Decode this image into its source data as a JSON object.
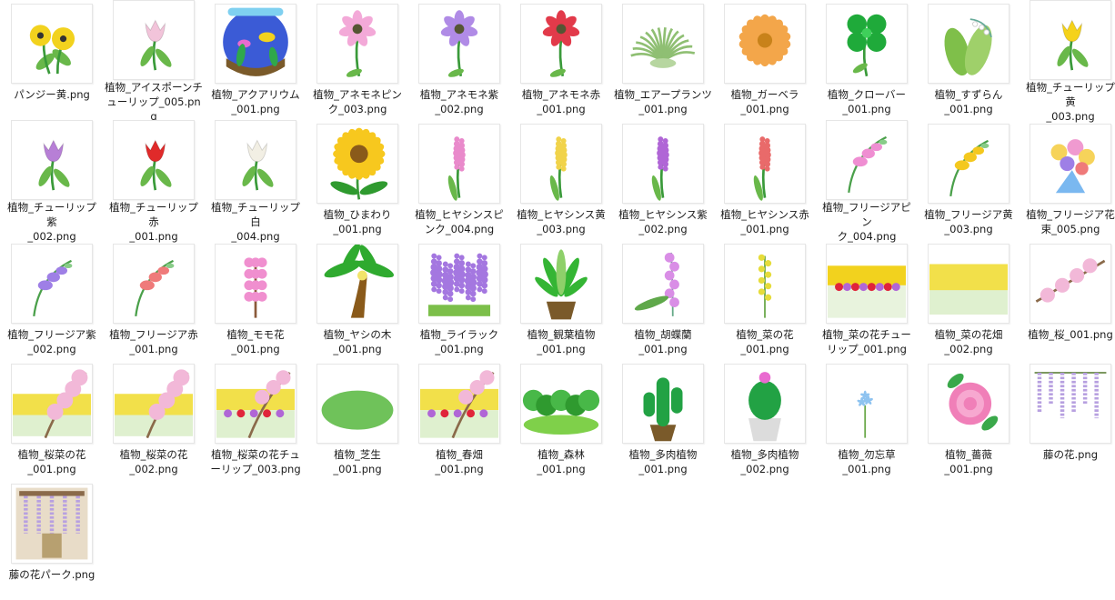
{
  "files": [
    {
      "label": "パンジー黄.png",
      "art": "pansy",
      "color": "#f2d21e"
    },
    {
      "label": "植物_アイスポーンチ\nューリップ_005.png",
      "art": "tulip",
      "color": "#f2c4da"
    },
    {
      "label": "植物_アクアリウム\n_001.png",
      "art": "aquarium",
      "color": "#3b5bd6"
    },
    {
      "label": "植物_アネモネピン\nク_003.png",
      "art": "anemone",
      "color": "#f3a9d8"
    },
    {
      "label": "植物_アネモネ紫\n_002.png",
      "art": "anemone",
      "color": "#b08be6"
    },
    {
      "label": "植物_アネモネ赤\n_001.png",
      "art": "anemone",
      "color": "#e23a4a"
    },
    {
      "label": "植物_エアープランツ\n_001.png",
      "art": "airplant",
      "color": "#8fbf73"
    },
    {
      "label": "植物_ガーベラ\n_001.png",
      "art": "gerbera",
      "color": "#f3a64a"
    },
    {
      "label": "植物_クローバー\n_001.png",
      "art": "clover",
      "color": "#1faa3a"
    },
    {
      "label": "植物_すずらん\n_001.png",
      "art": "lily",
      "color": "#7fbf4a"
    },
    {
      "label": "植物_チューリップ黄\n_003.png",
      "art": "tulip",
      "color": "#f5d21a"
    },
    {
      "label": "植物_チューリップ紫\n_002.png",
      "art": "tulip",
      "color": "#b77fd6"
    },
    {
      "label": "植物_チューリップ赤\n_001.png",
      "art": "tulip",
      "color": "#e02a2a"
    },
    {
      "label": "植物_チューリップ白\n_004.png",
      "art": "tulip",
      "color": "#f2efe4"
    },
    {
      "label": "植物_ひまわり\n_001.png",
      "art": "sunflower",
      "color": "#f7c81e"
    },
    {
      "label": "植物_ヒヤシンスピ\nンク_004.png",
      "art": "hyacinth",
      "color": "#e98acb"
    },
    {
      "label": "植物_ヒヤシンス黄\n_003.png",
      "art": "hyacinth",
      "color": "#f1d34a"
    },
    {
      "label": "植物_ヒヤシンス紫\n_002.png",
      "art": "hyacinth",
      "color": "#b066d6"
    },
    {
      "label": "植物_ヒヤシンス赤\n_001.png",
      "art": "hyacinth",
      "color": "#e96a6a"
    },
    {
      "label": "植物_フリージアピン\nク_004.png",
      "art": "freesia",
      "color": "#ef8ed2"
    },
    {
      "label": "植物_フリージア黄\n_003.png",
      "art": "freesia",
      "color": "#f4c81e"
    },
    {
      "label": "植物_フリージア花\n束_005.png",
      "art": "bouquet",
      "color": "#7ab8f0"
    },
    {
      "label": "植物_フリージア紫\n_002.png",
      "art": "freesia",
      "color": "#9e7fe6"
    },
    {
      "label": "植物_フリージア赤\n_001.png",
      "art": "freesia",
      "color": "#ef7a7a"
    },
    {
      "label": "植物_モモ花\n_001.png",
      "art": "peach",
      "color": "#f08fcf"
    },
    {
      "label": "植物_ヤシの木\n_001.png",
      "art": "palm",
      "color": "#2faa2f"
    },
    {
      "label": "植物_ライラック\n_001.png",
      "art": "lilac",
      "color": "#a477e0"
    },
    {
      "label": "植物_観葉植物\n_001.png",
      "art": "houseplant",
      "color": "#34b534"
    },
    {
      "label": "植物_胡蝶蘭\n_001.png",
      "art": "orchid",
      "color": "#d98ee6"
    },
    {
      "label": "植物_菜の花\n_001.png",
      "art": "rapeseed",
      "color": "#e6dc3a"
    },
    {
      "label": "植物_菜の花チュー\nリップ_001.png",
      "art": "field",
      "color": "#f2d21e"
    },
    {
      "label": "植物_菜の花畑\n_002.png",
      "art": "field2",
      "color": "#f2e04a"
    },
    {
      "label": "植物_桜_001.png",
      "art": "sakura",
      "color": "#f2b8d8"
    },
    {
      "label": "植物_桜菜の花\n_001.png",
      "art": "sakurafield",
      "color": "#f2b8d8"
    },
    {
      "label": "植物_桜菜の花\n_002.png",
      "art": "sakurafield",
      "color": "#f2b8d8"
    },
    {
      "label": "植物_桜菜の花チュ\nーリップ_003.png",
      "art": "sakuratulip",
      "color": "#f2b8d8"
    },
    {
      "label": "植物_芝生\n_001.png",
      "art": "lawn",
      "color": "#6fc25a"
    },
    {
      "label": "植物_春畑\n_001.png",
      "art": "sakuratulip",
      "color": "#f2b8d8"
    },
    {
      "label": "植物_森林\n_001.png",
      "art": "forest",
      "color": "#2f9a2f"
    },
    {
      "label": "植物_多肉植物\n_001.png",
      "art": "cactus",
      "color": "#22a244"
    },
    {
      "label": "植物_多肉植物\n_002.png",
      "art": "cactus2",
      "color": "#22a244"
    },
    {
      "label": "植物_勿忘草\n_001.png",
      "art": "forgetmenot",
      "color": "#8ec3f0"
    },
    {
      "label": "植物_薔薇\n_001.png",
      "art": "rose",
      "color": "#f07fb8"
    },
    {
      "label": "藤の花.png",
      "art": "wisteria",
      "color": "#b7a0e0"
    },
    {
      "label": "藤の花パーク.png",
      "art": "wisteriapark",
      "color": "#b7a0e0"
    }
  ]
}
